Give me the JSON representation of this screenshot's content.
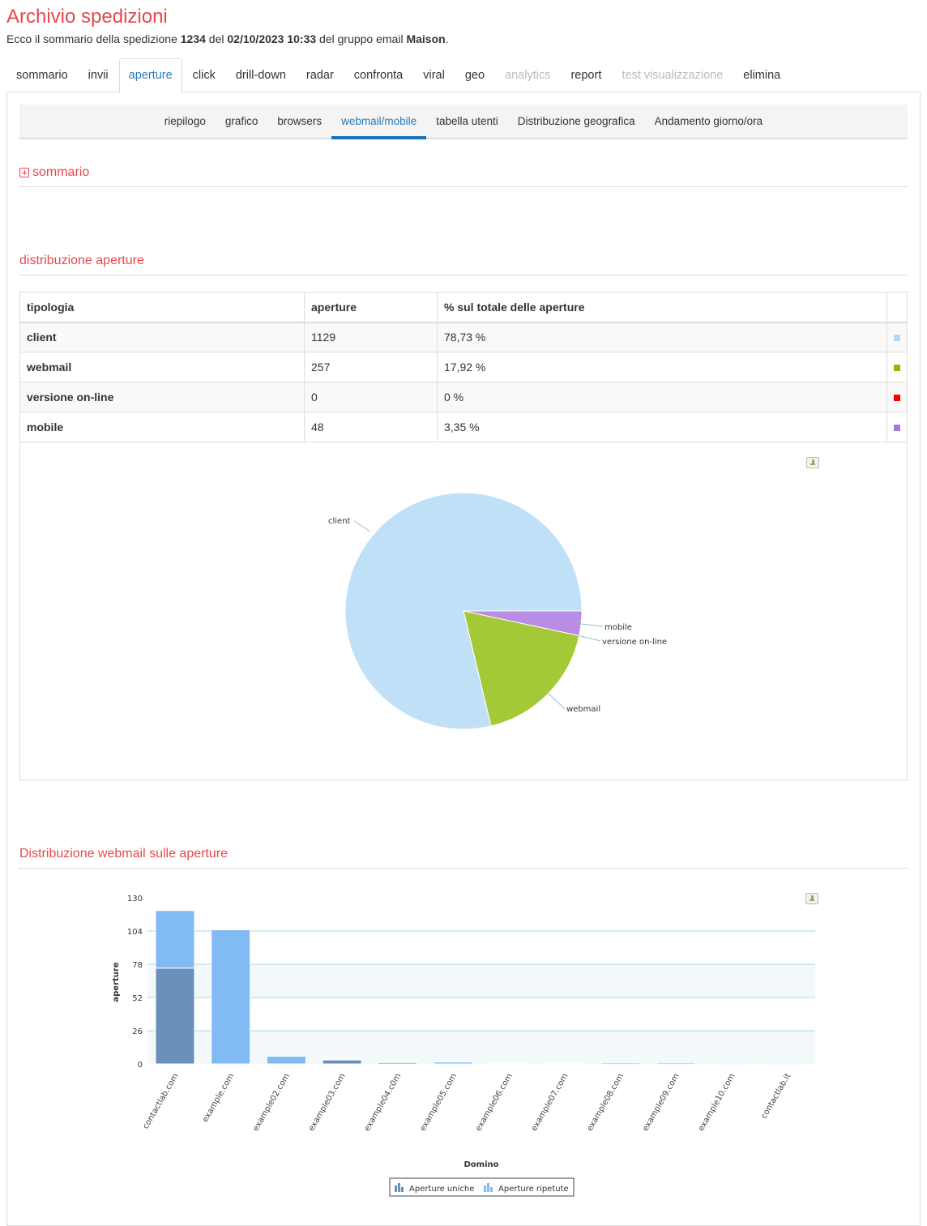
{
  "header": {
    "title": "Archivio spedizioni",
    "subtitle_prefix": "Ecco il sommario della spedizione ",
    "shipment_id": "1234",
    "subtitle_mid1": " del ",
    "datetime": "02/10/2023 10:33",
    "subtitle_mid2": " del gruppo email ",
    "group": "Maison",
    "subtitle_end": "."
  },
  "tabs": [
    {
      "label": "sommario",
      "state": "normal"
    },
    {
      "label": "invii",
      "state": "normal"
    },
    {
      "label": "aperture",
      "state": "active"
    },
    {
      "label": "click",
      "state": "normal"
    },
    {
      "label": "drill-down",
      "state": "normal"
    },
    {
      "label": "radar",
      "state": "normal"
    },
    {
      "label": "confronta",
      "state": "normal"
    },
    {
      "label": "viral",
      "state": "normal"
    },
    {
      "label": "geo",
      "state": "normal"
    },
    {
      "label": "analytics",
      "state": "disabled"
    },
    {
      "label": "report",
      "state": "normal"
    },
    {
      "label": "test visualizzazione",
      "state": "disabled"
    },
    {
      "label": "elimina",
      "state": "normal"
    }
  ],
  "subnav": [
    {
      "label": "riepilogo",
      "active": false
    },
    {
      "label": "grafico",
      "active": false
    },
    {
      "label": "browsers",
      "active": false
    },
    {
      "label": "webmail/mobile",
      "active": true
    },
    {
      "label": "tabella utenti",
      "active": false
    },
    {
      "label": "Distribuzione geografica",
      "active": false
    },
    {
      "label": "Andamento giorno/ora",
      "active": false
    }
  ],
  "sections": {
    "sommario": "sommario",
    "distribuzione": "distribuzione aperture",
    "webmail": "Distribuzione webmail sulle aperture"
  },
  "table": {
    "headers": [
      "tipologia",
      "aperture",
      "% sul totale delle aperture",
      ""
    ],
    "rows": [
      {
        "tipologia": "client",
        "aperture": "1129",
        "percent": "78,73 %",
        "color": "#b3d9f7"
      },
      {
        "tipologia": "webmail",
        "aperture": "257",
        "percent": "17,92 %",
        "color": "#8dbb00"
      },
      {
        "tipologia": "versione on-line",
        "aperture": "0",
        "percent": "0 %",
        "color": "#ff0000"
      },
      {
        "tipologia": "mobile",
        "aperture": "48",
        "percent": "3,35 %",
        "color": "#a678dd"
      }
    ]
  },
  "chart_data": [
    {
      "type": "pie",
      "labels": [
        "client",
        "webmail",
        "versione on-line",
        "mobile"
      ],
      "values": [
        1129,
        257,
        0,
        48
      ],
      "colors": [
        "#c0e0f8",
        "#a4c936",
        "#ff0000",
        "#b98de3"
      ]
    },
    {
      "type": "bar",
      "stacked": true,
      "categories": [
        "contactlab.com",
        "example.com",
        "example02.com",
        "example03.com",
        "example04.c0m",
        "example05.com",
        "example06.com",
        "example07.com",
        "example08.com",
        "example09.com",
        "example10.com",
        "contactlab.it"
      ],
      "series": [
        {
          "name": "Aperture uniche",
          "color": "#6a8fba",
          "values": [
            75,
            0,
            0,
            4,
            2,
            0,
            1.5,
            1.5,
            0,
            0,
            0,
            0
          ]
        },
        {
          "name": "Aperture ripetute",
          "color": "#82bbf3",
          "values": [
            45,
            105,
            6,
            0,
            0,
            1.5,
            0,
            0,
            1,
            1,
            0,
            0
          ]
        }
      ],
      "xlabel": "Domino",
      "ylabel": "aperture",
      "yticks": [
        0,
        26,
        52,
        78,
        104,
        130
      ],
      "ylim": [
        0,
        130
      ],
      "grid": true,
      "legend": "bottom-center"
    }
  ]
}
